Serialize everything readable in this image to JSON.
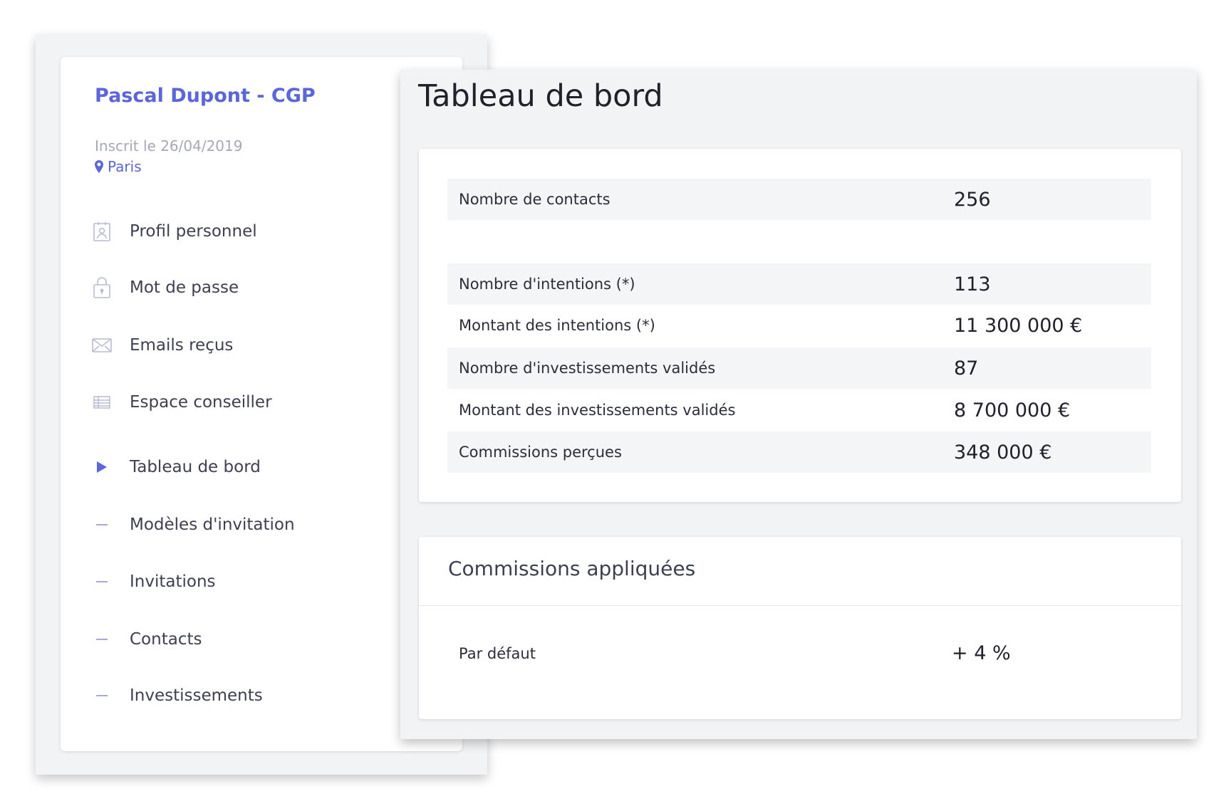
{
  "user": {
    "name": "Pascal Dupont - CGP",
    "registered": "Inscrit le 26/04/2019",
    "location": "Paris"
  },
  "menu": {
    "items": [
      {
        "label": "Profil personnel",
        "icon": "profile-icon"
      },
      {
        "label": "Mot de passe",
        "icon": "lock-icon"
      },
      {
        "label": "Emails reçus",
        "icon": "envelope-icon"
      },
      {
        "label": "Espace conseiller",
        "icon": "table-icon"
      }
    ],
    "subitems": [
      {
        "label": "Tableau de bord",
        "active": true
      },
      {
        "label": "Modèles d'invitation",
        "active": false
      },
      {
        "label": "Invitations",
        "active": false
      },
      {
        "label": "Contacts",
        "active": false
      },
      {
        "label": "Investissements",
        "active": false
      }
    ]
  },
  "dashboard": {
    "title": "Tableau de bord",
    "stats": [
      {
        "label": "Nombre de contacts",
        "value": "256"
      },
      {
        "label": "Nombre d'intentions (*)",
        "value": "113"
      },
      {
        "label": "Montant des intentions (*)",
        "value": "11 300 000 €"
      },
      {
        "label": "Nombre d'investissements validés",
        "value": "87"
      },
      {
        "label": "Montant des investissements validés",
        "value": "8 700 000 €"
      },
      {
        "label": "Commissions perçues",
        "value": "348 000 €"
      }
    ]
  },
  "commissions": {
    "title": "Commissions appliquées",
    "rows": [
      {
        "label": "Par défaut",
        "value": "+ 4 %"
      }
    ]
  },
  "colors": {
    "accent": "#5b66d8",
    "muted": "#a5a8b6",
    "panel": "#f2f3f5"
  }
}
